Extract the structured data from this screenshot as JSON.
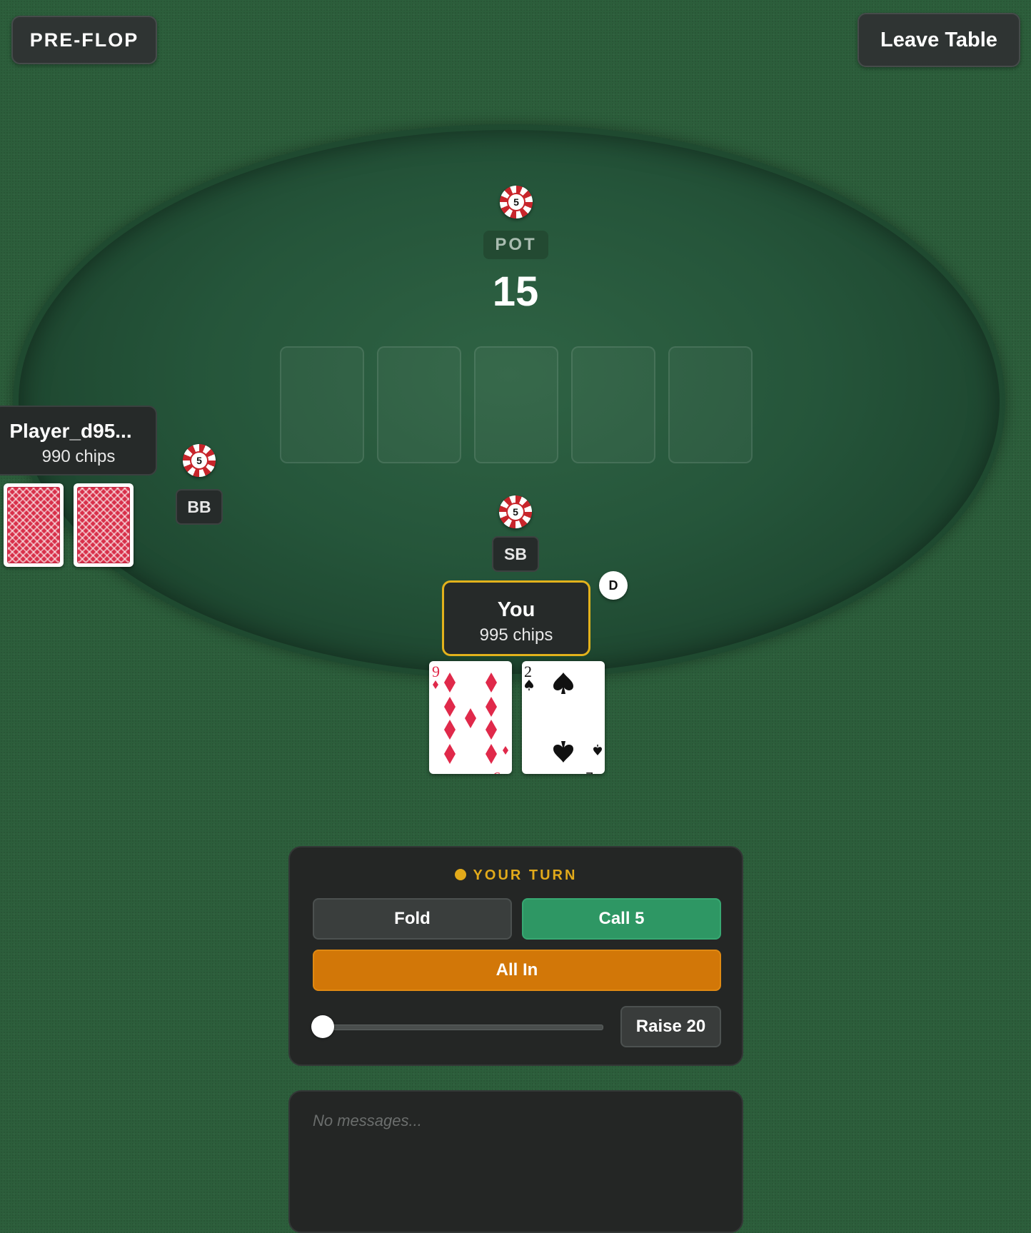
{
  "header": {
    "phase_label": "PRE-FLOP",
    "leave_label": "Leave Table"
  },
  "pot": {
    "label": "POT",
    "amount": "15",
    "chip_value": "5"
  },
  "board": {
    "cards_dealt": 0,
    "slots": 5
  },
  "opponent": {
    "name": "Player_d95...",
    "chips": "990 chips",
    "position": "BB",
    "bet_chip": "5",
    "hole_cards": [
      "card-back",
      "card-back"
    ]
  },
  "hero": {
    "name": "You",
    "chips": "995 chips",
    "position": "SB",
    "bet_chip": "5",
    "dealer_button": "D",
    "hole_cards": [
      {
        "rank": "9",
        "suit": "diamonds",
        "color": "#e0294a"
      },
      {
        "rank": "2",
        "suit": "spades",
        "color": "#111111"
      }
    ]
  },
  "actions": {
    "turn_label": "YOUR TURN",
    "fold_label": "Fold",
    "call_label": "Call 5",
    "allin_label": "All In",
    "raise_label": "Raise 20",
    "raise_slider_value": 0
  },
  "chat": {
    "empty_text": "No messages..."
  },
  "colors": {
    "felt": "#2c5e3b",
    "turn_accent": "#e2aa1a",
    "call_green": "#2e9764",
    "allin_orange": "#d27708"
  }
}
